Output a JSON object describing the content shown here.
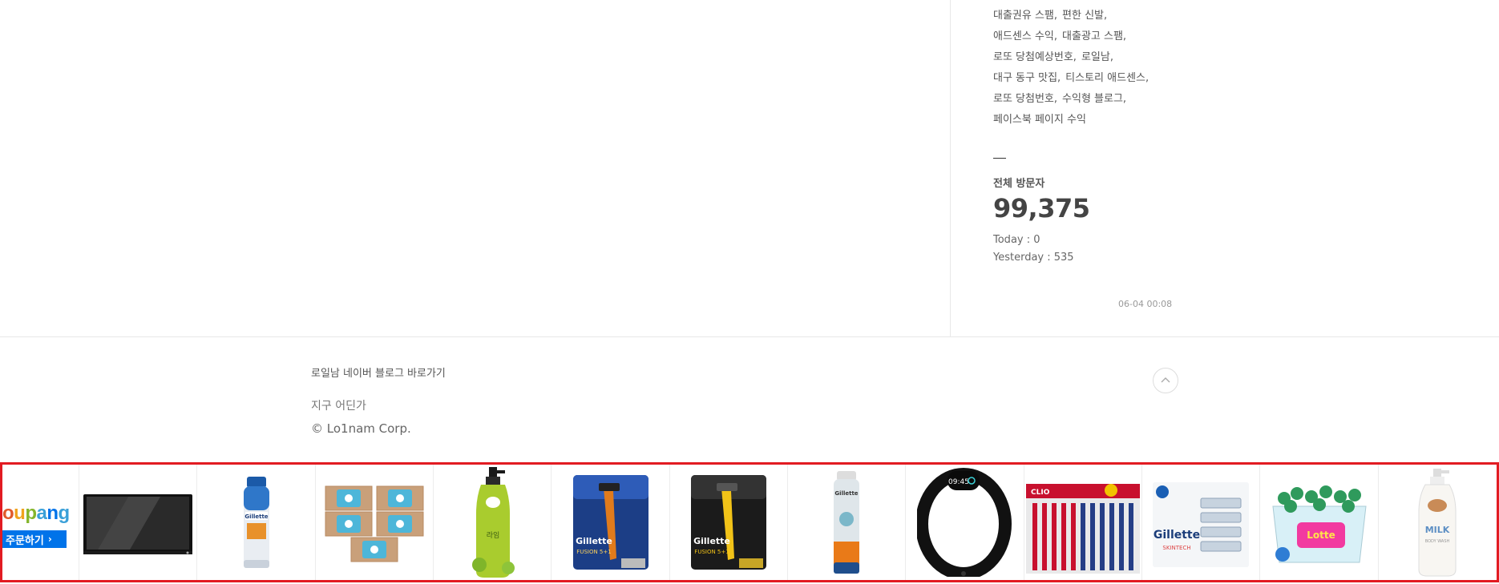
{
  "tags": {
    "lines": [
      [
        "대출권유 스팸,",
        "편한 신발,"
      ],
      [
        "애드센스 수익,",
        "대출광고 스팸,"
      ],
      [
        "로또 당첨예상번호,",
        "로일남,"
      ],
      [
        "대구 동구 맛집,",
        "티스토리 애드센스,"
      ],
      [
        "로또 당첨번호,",
        "수익형 블로그,"
      ],
      [
        "페이스북 페이지 수익"
      ]
    ]
  },
  "visitors": {
    "title": "전체 방문자",
    "total": "99,375",
    "today": "Today : 0",
    "yesterday": "Yesterday : 535"
  },
  "timestamp": "06-04 00:08",
  "footer": {
    "blog_link": "로일남 네이버 블로그 바로가기",
    "address": "지구 어딘가",
    "copyright": "© Lo1nam Corp."
  },
  "ad": {
    "logo_text": "oupang",
    "order_button": "주문하기",
    "products": [
      {
        "name": "monitor"
      },
      {
        "name": "gillette-shave-gel"
      },
      {
        "name": "soap-pack"
      },
      {
        "name": "lime-body-wash"
      },
      {
        "name": "gillette-fusion-razor"
      },
      {
        "name": "gillette-fusion-proshield-razor"
      },
      {
        "name": "gillette-foam-can"
      },
      {
        "name": "fitness-band"
      },
      {
        "name": "clio-toothbrush-set"
      },
      {
        "name": "gillette-skintech-cartridges"
      },
      {
        "name": "lotte-gum-tub"
      },
      {
        "name": "milk-body-wash"
      }
    ]
  },
  "colors": {
    "accent_red": "#e21b22",
    "coupang_blue": "#0073e9"
  }
}
